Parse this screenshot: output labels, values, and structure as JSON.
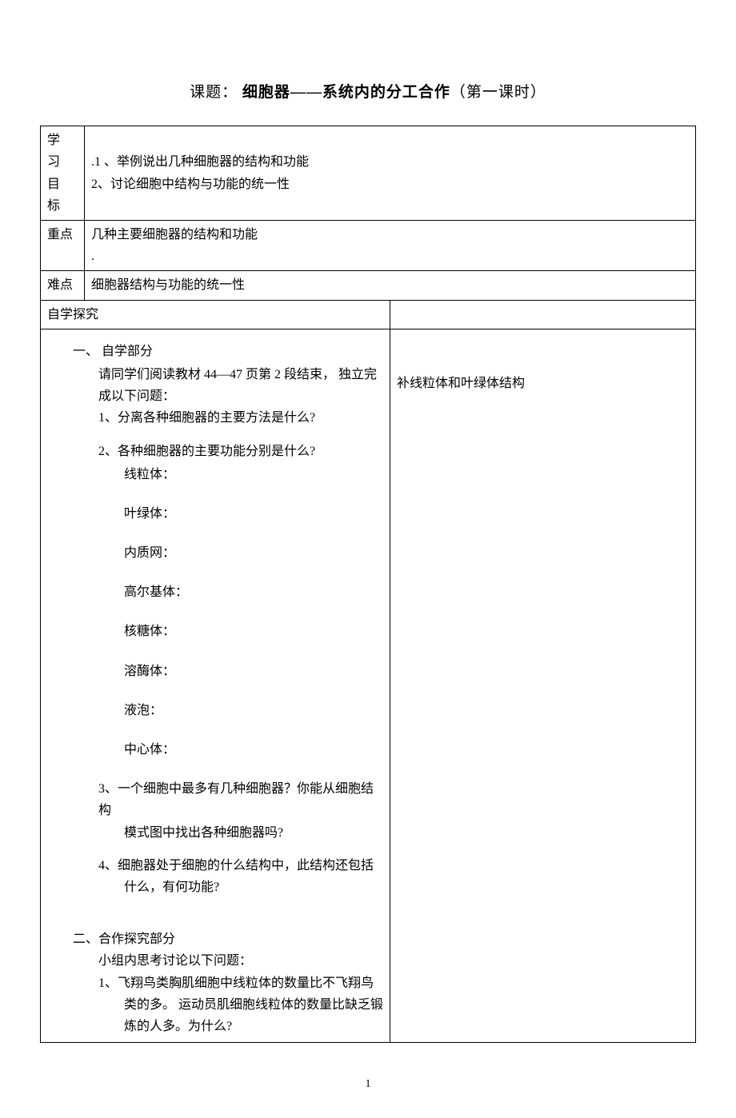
{
  "title": {
    "prefix": "课题：",
    "main": "细胞器——系统内的分工合作",
    "suffix": "（第一课时）"
  },
  "rows": {
    "goals_label": "学习目标",
    "goals_text": ".1 、举例说出几种细胞器的结构和功能\n2、讨论细胞中结构与功能的统一性",
    "focus_label": "重点",
    "focus_text": "几种主要细胞器的结构和功能\n.",
    "difficulty_label": "难点",
    "difficulty_text": "细胞器结构与功能的统一性",
    "self_study_label": "自学探究",
    "self_study_empty": ""
  },
  "content": {
    "section1": {
      "heading": "一、 自学部分",
      "intro1": "请同学们阅读教材 44—47 页第 2 段结束， 独立完",
      "intro2": "成以下问题：",
      "q1": "1、分离各种细胞器的主要方法是什么?",
      "q2": "2、各种细胞器的主要功能分别是什么?",
      "organelles": {
        "o1": "线粒体：",
        "o2": "叶绿体：",
        "o3": "内质网：",
        "o4": "高尔基体：",
        "o5": "核糖体：",
        "o6": "溶酶体：",
        "o7": "液泡：",
        "o8": "中心体："
      },
      "q3a": "3、一个细胞中最多有几种细胞器？你能从细胞结构",
      "q3b": "模式图中找出各种细胞器吗?",
      "q4a": "4、细胞器处于细胞的什么结构中，此结构还包括",
      "q4b": "什么，有何功能?"
    },
    "section2": {
      "heading": "二、合作探究部分",
      "intro": "小组内思考讨论以下问题：",
      "q1a": "1、飞翔鸟类胸肌细胞中线粒体的数量比不飞翔鸟",
      "q1b": "类的多。 运动员肌细胞线粒体的数量比缺乏锻",
      "q1c": "炼的人多。为什么?"
    }
  },
  "right_note": "补线粒体和叶绿体结构",
  "page_number": "1"
}
